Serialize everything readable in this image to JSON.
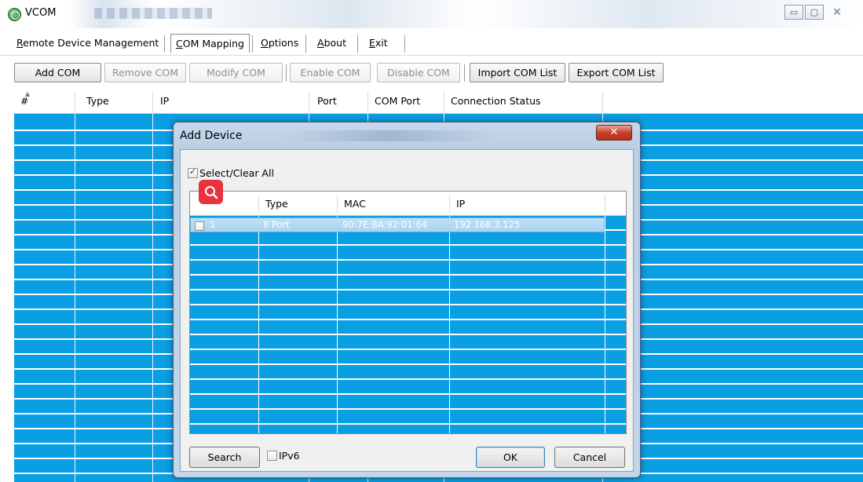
{
  "window": {
    "title": "VCOM"
  },
  "menu": {
    "remote": "Remote Device Management",
    "com_mapping": "COM Mapping",
    "options": "Options",
    "about": "About",
    "exit": "Exit"
  },
  "toolbar": {
    "add_com": "Add COM",
    "remove_com": "Remove COM",
    "modify_com": "Modify COM",
    "enable_com": "Enable COM",
    "disable_com": "Disable COM",
    "import_com_list": "Import COM List",
    "export_com_list": "Export COM List"
  },
  "main_table": {
    "columns": [
      "#",
      "Type",
      "IP",
      "Port",
      "COM Port",
      "Connection Status"
    ]
  },
  "dialog": {
    "title": "Add Device",
    "select_all": "Select/Clear All",
    "select_all_checked": true,
    "columns": [
      "",
      "Type",
      "MAC",
      "IP"
    ],
    "rows": [
      {
        "no": "1",
        "type": "8 Port",
        "mac": "90:7E:BA:92:01:64",
        "ip": "192.168.3.125",
        "checked": false
      }
    ],
    "search_label": "Search",
    "ipv6_label": "IPv6",
    "ipv6_checked": false,
    "ok_label": "OK",
    "cancel_label": "Cancel"
  },
  "colors": {
    "list_bg": "#0a9ee3",
    "close_button": "#c7402c",
    "search_badge": "#e8323e"
  }
}
